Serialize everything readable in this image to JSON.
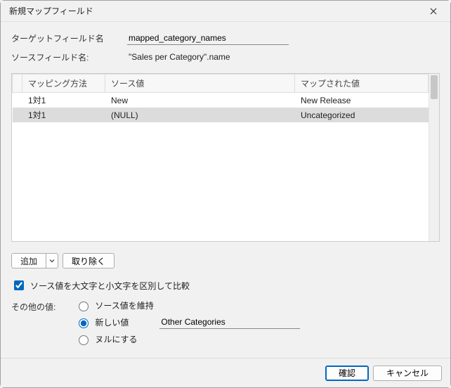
{
  "window": {
    "title": "新規マップフィールド"
  },
  "fields": {
    "target_label": "ターゲットフィールド名",
    "target_value": "mapped_category_names",
    "source_label": "ソースフィールド名:",
    "source_value": "\"Sales per Category\".name"
  },
  "table": {
    "headers": {
      "method": "マッピング方法",
      "source": "ソース値",
      "mapped": "マップされた値"
    },
    "rows": [
      {
        "method": "1対1",
        "source": "New",
        "mapped": "New Release",
        "selected": false
      },
      {
        "method": "1対1",
        "source": "(NULL)",
        "mapped": "Uncategorized",
        "selected": true
      }
    ]
  },
  "buttons": {
    "add": "追加",
    "remove": "取り除く",
    "ok": "確認",
    "cancel": "キャンセル"
  },
  "options": {
    "case_sensitive_label": "ソース値を大文字と小文字を区別して比較",
    "case_sensitive_checked": true,
    "other_values_label": "その他の値:",
    "radio": {
      "keep_source": "ソース値を維持",
      "new_value": "新しい値",
      "set_null": "ヌルにする",
      "selected": "new_value"
    },
    "new_value_text": "Other Categories"
  }
}
